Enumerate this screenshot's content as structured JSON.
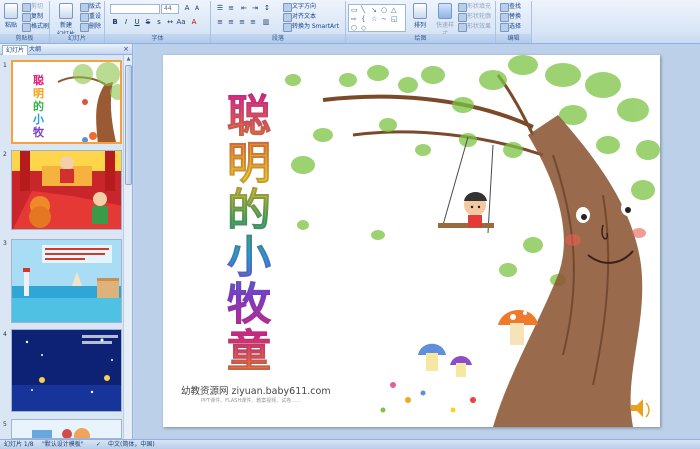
{
  "ribbon": {
    "clipboard": {
      "label": "剪贴板",
      "paste": "粘贴",
      "cut": "剪切",
      "copy": "复制",
      "painter": "格式刷"
    },
    "slides": {
      "label": "幻灯片",
      "new_slide": "新建\n幻灯片",
      "layout": "版式",
      "reset": "重设",
      "delete": "删除"
    },
    "font": {
      "label": "字体",
      "font_name": "",
      "font_size": "44"
    },
    "paragraph": {
      "label": "段落",
      "text_direction": "文字方向",
      "align_text": "对齐文本",
      "convert_smartart": "转换为 SmartArt"
    },
    "drawing": {
      "label": "绘图",
      "arrange": "排列",
      "quick_styles": "快速样式",
      "shape_fill": "形状填充",
      "shape_outline": "形状轮廓",
      "shape_effects": "形状效果"
    },
    "editing": {
      "label": "编辑",
      "find": "查找",
      "replace": "替换",
      "select": "选择"
    }
  },
  "pane": {
    "tab_slides": "幻灯片",
    "tab_outline": "大纲",
    "close": "×",
    "thumb_numbers": [
      "1",
      "2",
      "3",
      "4",
      "5"
    ]
  },
  "slide": {
    "title_chars": [
      "聪",
      "明",
      "的",
      "小",
      "牧",
      "童"
    ],
    "watermark": "幼教资源网 ziyuan.baby611.com",
    "watermark_sub": "PPT课件、FLASH课件、教案视频、试卷……"
  },
  "status": {
    "slide_info": "幻灯片 1/8",
    "theme": "\"默认设计模板\"",
    "language": "中文(简体，中国)"
  },
  "colors": {
    "ribbon_bg": "#d9e6f6",
    "accent": "#15428b",
    "selected_border": "#f4a23c"
  }
}
